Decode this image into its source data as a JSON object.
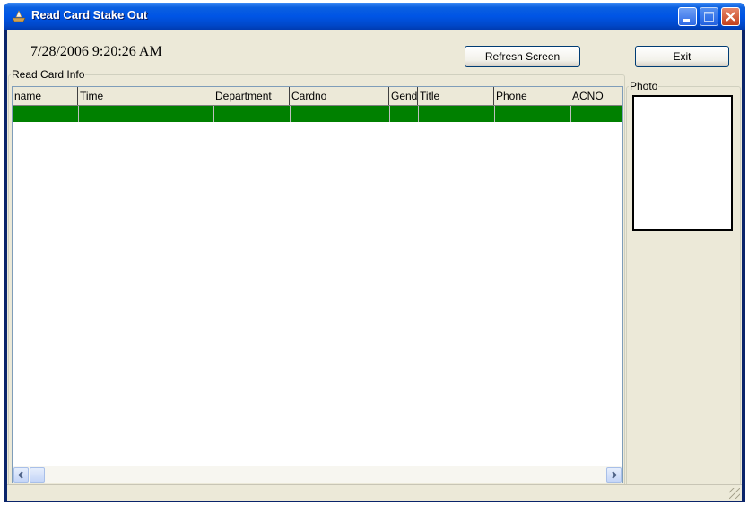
{
  "window": {
    "title": "Read Card Stake Out",
    "icon": "ship-icon"
  },
  "header": {
    "datetime": "7/28/2006 9:20:26 AM",
    "refresh_label": "Refresh Screen",
    "exit_label": "Exit"
  },
  "read_card_info": {
    "legend": "Read Card Info",
    "columns": [
      "name",
      "Time",
      "Department",
      "Cardno",
      "Gend",
      "Title",
      "Phone",
      "ACNO"
    ],
    "selected_row_color": "#008000"
  },
  "photo": {
    "legend": "Photo"
  },
  "colors": {
    "titlebar": "#0055e5",
    "client_bg": "#ece9d8",
    "close_button": "#c4401c"
  }
}
